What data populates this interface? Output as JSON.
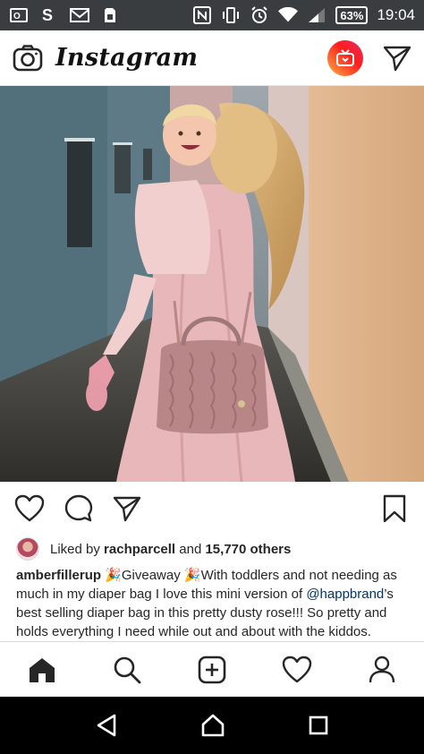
{
  "status_bar": {
    "battery": "63%",
    "time": "19:04",
    "icons": [
      "outlook-icon",
      "sway-icon",
      "gmail-icon",
      "sim-icon",
      "nfc-icon",
      "vibrate-icon",
      "alarm-icon",
      "wifi-icon",
      "signal-icon",
      "battery-icon"
    ]
  },
  "header": {
    "logo": "Instagram",
    "icons": [
      "camera-icon",
      "igtv-icon",
      "direct-message-icon"
    ]
  },
  "post": {
    "photo_alt": "mother-and-daughter-photo",
    "likes": {
      "prefix": "Liked by ",
      "user": "rachparcell",
      "middle": " and ",
      "count": "15,770 others"
    },
    "caption": {
      "username": "amberfillerup",
      "part1": " 🎉Giveaway 🎉With toddlers and not needing as much in my diaper bag I love this mini version of ",
      "mention": "@happbrand",
      "part2": "’s best selling diaper bag in this pretty dusty rose!!! So pretty and holds everything I need while out and about with the kiddos."
    }
  },
  "colors": {
    "status_bar": "#3a3d40",
    "mention": "#003569",
    "igtv_gradient_start": "#fcb045",
    "igtv_gradient_end": "#e1306c"
  }
}
